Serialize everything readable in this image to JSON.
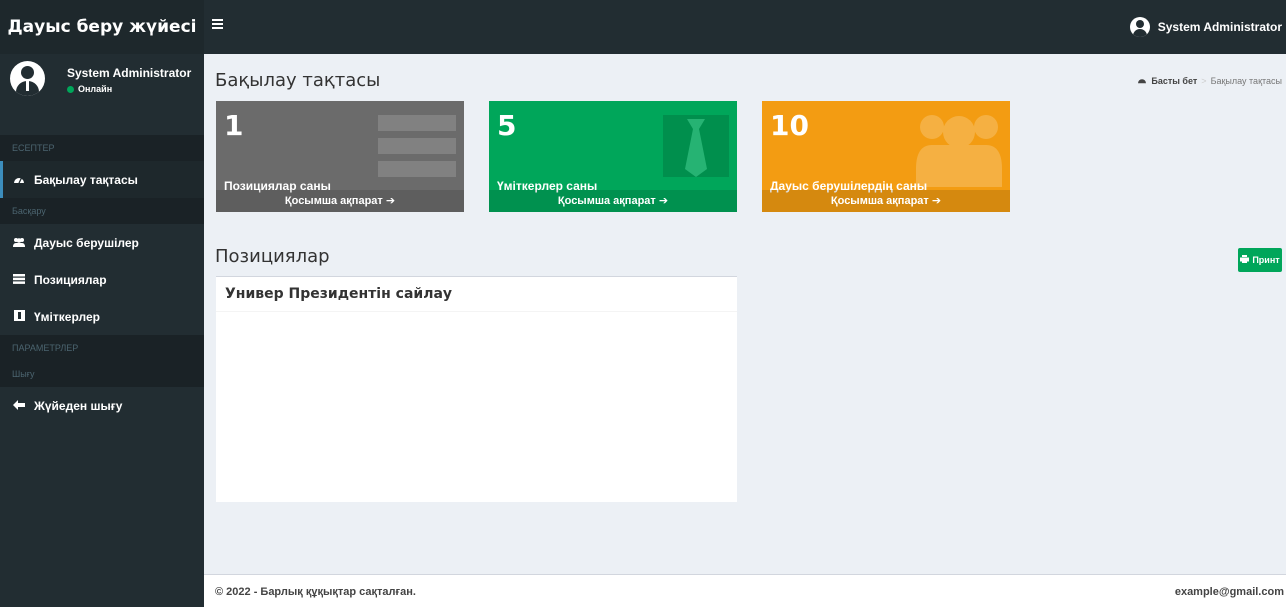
{
  "app": {
    "title": "Дауыс беру жүйесі"
  },
  "topbar": {
    "user_name": "System Administrator"
  },
  "sidebar": {
    "user": {
      "name": "System Administrator",
      "status": "Онлайн"
    },
    "sections": {
      "reports": "ЕСЕПТЕР",
      "manage": "Басқару",
      "settings": "ПАРАМЕТРЛЕР",
      "exit": "Шығу"
    },
    "items": {
      "dashboard": "Бақылау тақтасы",
      "voters": "Дауыс берушілер",
      "positions": "Позициялар",
      "candidates": "Үміткерлер",
      "logout": "Жүйеден шығу"
    }
  },
  "page": {
    "title": "Бақылау тақтасы",
    "breadcrumb": {
      "home": "Басты бет",
      "current": "Бақылау тақтасы"
    }
  },
  "stats": {
    "positions": {
      "value": "1",
      "label": "Позициялар саны",
      "more": "Қосымша ақпарат"
    },
    "candidates": {
      "value": "5",
      "label": "Үміткерлер саны",
      "more": "Қосымша ақпарат"
    },
    "voters": {
      "value": "10",
      "label": "Дауыс берушілердің саны",
      "more": "Қосымша ақпарат"
    }
  },
  "positions_section": {
    "title": "Позициялар",
    "print_label": "Принт",
    "panel_title": "Универ Президентін сайлау"
  },
  "footer": {
    "copyright": "© 2022 - Барлық құқықтар сақталған.",
    "email": "example@gmail.com"
  },
  "colors": {
    "sidebar": "#222d32",
    "gray_box": "#6b6b6b",
    "green_box": "#00a65a",
    "orange_box": "#f39c12",
    "active_accent": "#3c8dbc"
  }
}
